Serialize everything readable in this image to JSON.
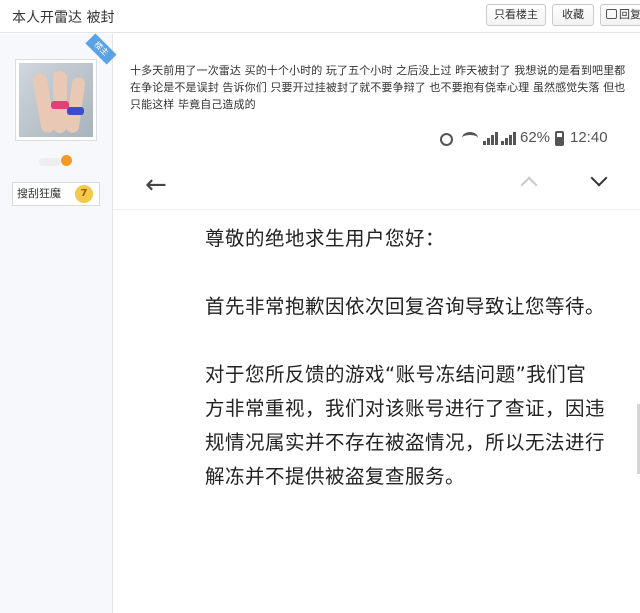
{
  "header": {
    "thread_title": "本人开雷达 被封",
    "buttons": {
      "only_op": "只看楼主",
      "favorite": "收藏",
      "reply": "回复"
    }
  },
  "author": {
    "badge": "楼主",
    "username": "搜刮狂魔",
    "level": "7"
  },
  "post": {
    "text": "十多天前用了一次雷达 买的十个小时的 玩了五个小时 之后没上过 昨天被封了 我想说的是看到吧里都在争论是不是误封 告诉你们 只要开过挂被封了就不要争辩了 也不要抱有侥幸心理 虽然感觉失落 但也只能这样 毕竟自己造成的"
  },
  "phone": {
    "status_bar": {
      "battery": "62%",
      "time": "12:40",
      "icons": [
        "alarm-icon",
        "wifi-icon",
        "signal-icon",
        "signal-icon",
        "battery-icon"
      ]
    },
    "mail": {
      "greeting": "尊敬的绝地求生用户您好：",
      "para1": "首先非常抱歉因依次回复咨询导致让您等待。",
      "para2": "对于您所反馈的游戏“账号冻结问题”我们官方非常重视，我们对该账号进行了查证，因违规情况属实并不存在被盗情况，所以无法进行解冻并不提供被盗复查服务。"
    }
  }
}
